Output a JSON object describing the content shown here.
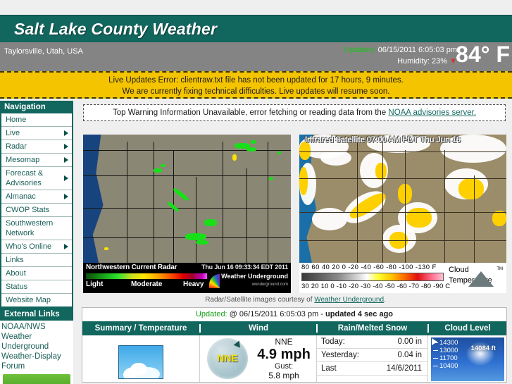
{
  "header": {
    "site_title": "Salt Lake County Weather",
    "location": "Taylorsville, Utah, USA",
    "updated_label": "Updated:",
    "updated_value": "06/15/2011  6:05:03 pm",
    "humidity_label": "Humidity:",
    "humidity_value": "23%",
    "humidity_trend_icon": "down-arrow-icon",
    "temperature": "84° F",
    "bar_color": "#11665e",
    "subbar_color": "#848484"
  },
  "alert": {
    "line1": "Live Updates Error: clientraw.txt file has not been updated for 17 hours, 9 minutes.",
    "line2": "We are currently fixing technical difficulties. Live updates will resume soon.",
    "bg_color": "#f5c400"
  },
  "warning_box": {
    "text": "Top Warning Information Unavailable, error fetching or reading data from the ",
    "link": "NOAA advisories server."
  },
  "sidebar": {
    "nav_heading": "Navigation",
    "items": [
      {
        "label": "Home",
        "has_submenu": false
      },
      {
        "label": "Live",
        "has_submenu": true
      },
      {
        "label": "Radar",
        "has_submenu": true
      },
      {
        "label": "Mesomap",
        "has_submenu": true
      },
      {
        "label": "Forecast & Advisories",
        "has_submenu": true
      },
      {
        "label": "Almanac",
        "has_submenu": true
      },
      {
        "label": "CWOP Stats",
        "has_submenu": false
      },
      {
        "label": "Southwestern Network",
        "has_submenu": false
      },
      {
        "label": "Who's Online",
        "has_submenu": true
      },
      {
        "label": "Links",
        "has_submenu": false
      },
      {
        "label": "About",
        "has_submenu": false
      },
      {
        "label": "Status",
        "has_submenu": false
      },
      {
        "label": "Website Map",
        "has_submenu": false
      }
    ],
    "external_heading": "External Links",
    "external_items": [
      {
        "label": "NOAA/NWS"
      },
      {
        "label": "Weather Underground"
      },
      {
        "label": "Weather-Display Forum"
      }
    ]
  },
  "radar": {
    "title": "Northwestern Current Radar",
    "timestamp": "Thu Jun 16 09:33:34 EDT 2011",
    "legend_light": "Light",
    "legend_moderate": "Moderate",
    "legend_heavy": "Heavy",
    "provider": "Weather Underground",
    "provider_sub": "wunderground.com"
  },
  "satellite": {
    "title": "Infrared Satellite 07:00 AM PDT Thu Jun 16",
    "scale_f": "80  60  40  20   0  -20 -40 -60 -80 -100  -130 F",
    "scale_c": "30 20 10  0 -10 -20 -30 -40 -50 -60 -70 -80 -90  C",
    "legend_line1": "Cloud",
    "legend_line2": "Temperature",
    "tm": "TM"
  },
  "courtesy": {
    "text": "Radar/Satellite images courtesy of ",
    "link": "Weather Underground",
    "suffix": "."
  },
  "table": {
    "updated_label": "Updated:",
    "updated_value": "@ 06/15/2011 6:05:03 pm - ",
    "updated_ago": "updated 4 sec ago",
    "headers": [
      "Summary / Temperature",
      "Wind",
      "Rain/Melted Snow",
      "Cloud Level"
    ],
    "summary": {
      "icon": "partly-cloudy-icon"
    },
    "wind": {
      "compass_label": "NNE",
      "direction": "NNE",
      "speed": "4.9 mph",
      "gust_label": "Gust:",
      "gust_value": "5.8 mph"
    },
    "rain": [
      {
        "label": "Today:",
        "value": "0.00 in"
      },
      {
        "label": "Yesterday:",
        "value": "0.04 in"
      },
      {
        "label": "Last",
        "value": "14/6/2011"
      }
    ],
    "cloud": {
      "ticks": [
        "14300",
        "13000",
        "11700",
        "10400"
      ],
      "value": "14084 ft"
    },
    "header_color": "#11665e"
  }
}
